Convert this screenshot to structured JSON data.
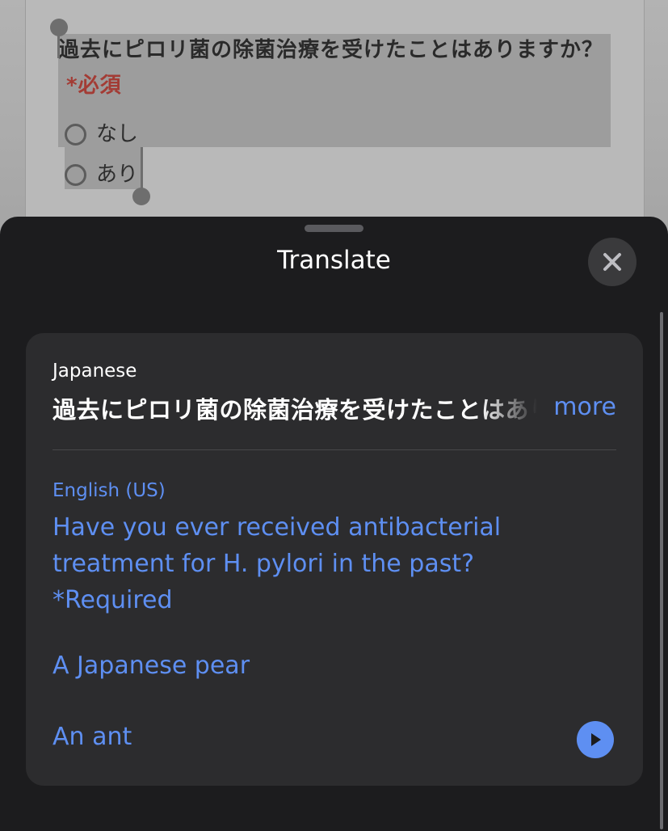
{
  "background_form": {
    "question": "過去にピロリ菌の除菌治療を受けたことはありますか？",
    "required_marker": "*必須",
    "options": [
      {
        "label": "なし"
      },
      {
        "label": "あり"
      }
    ]
  },
  "translate_sheet": {
    "title": "Translate",
    "close_icon": "close-icon",
    "source": {
      "language": "Japanese",
      "text": "過去にピロリ菌の除菌治療を受けたことはありますか？",
      "more_label": "more"
    },
    "target": {
      "language": "English (US)",
      "text": "Have you ever received antibacterial treatment for H. pylori in the past? *Required"
    },
    "alternatives": [
      {
        "text": "A Japanese pear"
      },
      {
        "text": "An ant"
      }
    ],
    "play_icon": "play-icon"
  },
  "colors": {
    "accent": "#5e8ff2",
    "sheet_bg": "#1c1c1e",
    "card_bg": "#2c2c2e",
    "required_red": "#a33c35"
  }
}
